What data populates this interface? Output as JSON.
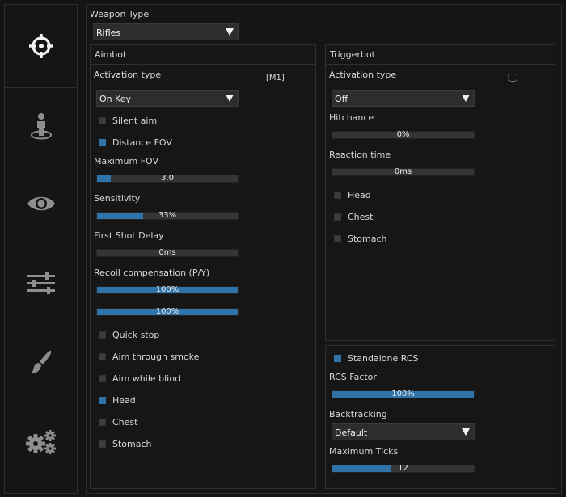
{
  "sidebar": {
    "tabs": [
      {
        "name": "aimbot",
        "icon": "crosshair-icon",
        "active": true
      },
      {
        "name": "player",
        "icon": "player-icon",
        "active": false
      },
      {
        "name": "visuals",
        "icon": "eye-icon",
        "active": false
      },
      {
        "name": "misc",
        "icon": "sliders-icon",
        "active": false
      },
      {
        "name": "skins",
        "icon": "brush-icon",
        "active": false
      },
      {
        "name": "config",
        "icon": "gears-icon",
        "active": false
      }
    ]
  },
  "weapon": {
    "label": "Weapon Type",
    "value": "Rifles"
  },
  "aimbot": {
    "title": "Aimbot",
    "activation_label": "Activation type",
    "key": "[M1]",
    "activation_value": "On Key",
    "silent_aim": {
      "label": "Silent aim",
      "checked": false
    },
    "distance_fov": {
      "label": "Distance FOV",
      "checked": true
    },
    "max_fov": {
      "label": "Maximum FOV",
      "text": "3.0",
      "fill": 0.1
    },
    "sensitivity": {
      "label": "Sensitivity",
      "text": "33%",
      "fill": 0.33
    },
    "first_shot_delay": {
      "label": "First Shot Delay",
      "text": "0ms",
      "fill": 0
    },
    "recoil_label": "Recoil compensation (P/Y)",
    "recoil_pitch": {
      "text": "100%",
      "fill": 1.0
    },
    "recoil_yaw": {
      "text": "100%",
      "fill": 1.0
    },
    "quick_stop": {
      "label": "Quick stop",
      "checked": false
    },
    "aim_through_smoke": {
      "label": "Aim through smoke",
      "checked": false
    },
    "aim_while_blind": {
      "label": "Aim while blind",
      "checked": false
    },
    "head": {
      "label": "Head",
      "checked": true
    },
    "chest": {
      "label": "Chest",
      "checked": false
    },
    "stomach": {
      "label": "Stomach",
      "checked": false
    }
  },
  "triggerbot": {
    "title": "Triggerbot",
    "activation_label": "Activation type",
    "key": "[_]",
    "activation_value": "Off",
    "hitchance": {
      "label": "Hitchance",
      "text": "0%",
      "fill": 0
    },
    "reaction_time": {
      "label": "Reaction time",
      "text": "0ms",
      "fill": 0
    },
    "head": {
      "label": "Head",
      "checked": false
    },
    "chest": {
      "label": "Chest",
      "checked": false
    },
    "stomach": {
      "label": "Stomach",
      "checked": false
    }
  },
  "rcs": {
    "standalone": {
      "label": "Standalone RCS",
      "checked": true
    },
    "factor": {
      "label": "RCS Factor",
      "text": "100%",
      "fill": 1.0
    },
    "backtracking_label": "Backtracking",
    "backtracking_value": "Default",
    "max_ticks": {
      "label": "Maximum Ticks",
      "text": "12",
      "fill": 0.41
    }
  },
  "colors": {
    "accent": "#2f73a8",
    "background": "#141414",
    "panel_border": "#2f2f2f",
    "control": "#2d2d2d",
    "text": "#d8d8d8"
  }
}
